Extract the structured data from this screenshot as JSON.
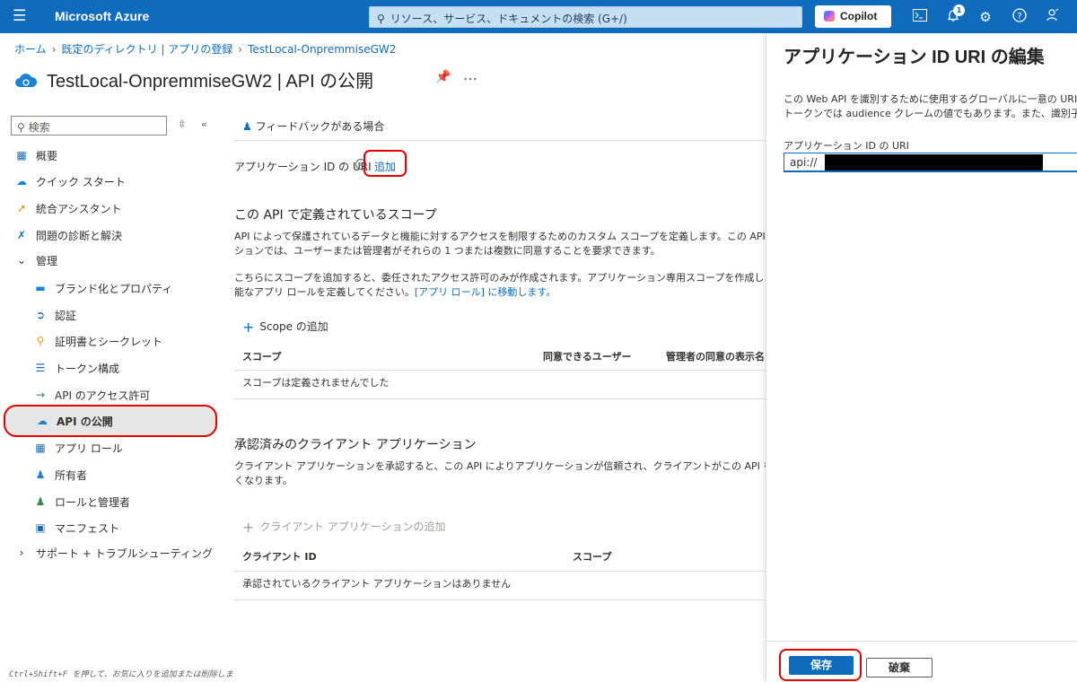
{
  "topbar": {
    "brand": "Microsoft Azure",
    "search_placeholder": "リソース、サービス、ドキュメントの検索 (G+/)",
    "copilot_label": "Copilot",
    "notification_count": "1"
  },
  "breadcrumb": [
    "ホーム",
    "既定のディレクトリ | アプリの登録",
    "TestLocal-OnpremmiseGW2"
  ],
  "page": {
    "title": "TestLocal-OnpremmiseGW2 | API の公開",
    "more": "…"
  },
  "sidebar": {
    "search_placeholder": "検索",
    "items": [
      {
        "label": "概要",
        "icon": "grid-icon"
      },
      {
        "label": "クイック スタート",
        "icon": "cloud-bolt-icon"
      },
      {
        "label": "統合アシスタント",
        "icon": "rocket-icon"
      },
      {
        "label": "問題の診断と解決",
        "icon": "wrench-icon"
      },
      {
        "label": "管理",
        "icon": "chevron-down-icon"
      },
      {
        "label": "ブランド化とプロパティ",
        "icon": "card-icon"
      },
      {
        "label": "認証",
        "icon": "auth-icon"
      },
      {
        "label": "証明書とシークレット",
        "icon": "key-icon"
      },
      {
        "label": "トークン構成",
        "icon": "bars-icon"
      },
      {
        "label": "API のアクセス許可",
        "icon": "api-permission-icon"
      },
      {
        "label": "API の公開",
        "icon": "cloud-icon"
      },
      {
        "label": "アプリ ロール",
        "icon": "app-role-icon"
      },
      {
        "label": "所有者",
        "icon": "people-icon"
      },
      {
        "label": "ロールと管理者",
        "icon": "role-admin-icon"
      },
      {
        "label": "マニフェスト",
        "icon": "manifest-icon"
      },
      {
        "label": "サポート + トラブルシューティング",
        "icon": "chevron-right-icon"
      }
    ],
    "hint": "Ctrl+Shift+F を押して、お気に入りを追加または削除しま"
  },
  "main": {
    "feedback": "フィードバックがある場合",
    "app_id_uri_label": "アプリケーション ID の URI",
    "add_link": "追加",
    "scopes": {
      "title": "この API で定義されているスコープ",
      "desc_line1": "API によって保護されているデータと機能に対するアクセスを制限するためのカスタム スコープを定義します。この API の一部にア",
      "desc_line2": "ションでは、ユーザーまたは管理者がそれらの 1 つまたは複数に同意することを要求できます。",
      "desc_line3": "こちらにスコープを追加すると、委任されたアクセス許可のみが作成されます。アプリケーション専用スコープを作成しようとしている場",
      "desc_line4_pre": "能なアプリ ロールを定義してください。",
      "desc_line4_link": "[アプリ ロール] に移動します。",
      "add_scope": "Scope の追加",
      "columns": [
        "スコープ",
        "同意できるユーザー",
        "管理者の同意の表示名"
      ],
      "empty": "スコープは定義されませんでした"
    },
    "clients": {
      "title": "承認済みのクライアント アプリケーション",
      "desc_line1": "クライアント アプリケーションを承認すると、この API によりアプリケーションが信頼され、クライアントがこの API を呼び出す際にユ",
      "desc_line2": "くなります。",
      "add_client": "クライアント アプリケーションの追加",
      "columns": [
        "クライアント ID",
        "スコープ"
      ],
      "empty": "承認されているクライアント アプリケーションはありません"
    }
  },
  "panel": {
    "title": "アプリケーション ID URI の編集",
    "desc_line1": "この Web API を識別するために使用するグローバルに一意の URI。ス",
    "desc_line2": "トークンでは audience クレームの値でもあります。また、識別子 URI",
    "field_label": "アプリケーション ID の URI",
    "field_value": "api://",
    "save": "保存",
    "discard": "破棄"
  },
  "colors": {
    "accent": "#0f6cbd",
    "highlight": "#e60000"
  }
}
